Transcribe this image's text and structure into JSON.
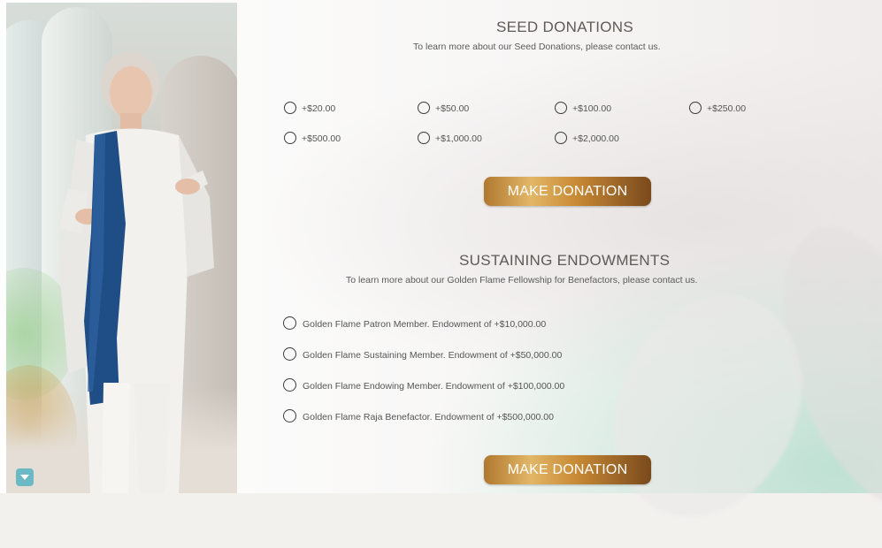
{
  "seed": {
    "title": "SEED DONATIONS",
    "subtitle": "To learn more about our Seed Donations, please contact us.",
    "options": [
      "+$20.00",
      "+$50.00",
      "+$100.00",
      "+$250.00",
      "+$500.00",
      "+$1,000.00",
      "+$2,000.00"
    ],
    "button": "MAKE DONATION"
  },
  "endowments": {
    "title": "SUSTAINING ENDOWMENTS",
    "subtitle": "To learn more about our Golden Flame Fellowship for Benefactors, please contact us.",
    "options": [
      "Golden Flame Patron Member. Endowment of +$10,000.00",
      "Golden Flame Sustaining Member. Endowment of +$50,000.00",
      "Golden Flame Endowing Member. Endowment of +$100,000.00",
      "Golden Flame Raja Benefactor. Endowment of +$500,000.00"
    ],
    "button": "MAKE DONATION"
  },
  "colors": {
    "button_gold": "#c88a35",
    "accent_teal": "#6cb9c6",
    "scarf_blue": "#1f4e86"
  },
  "icons": {
    "scroll": "chevron-down-icon"
  }
}
